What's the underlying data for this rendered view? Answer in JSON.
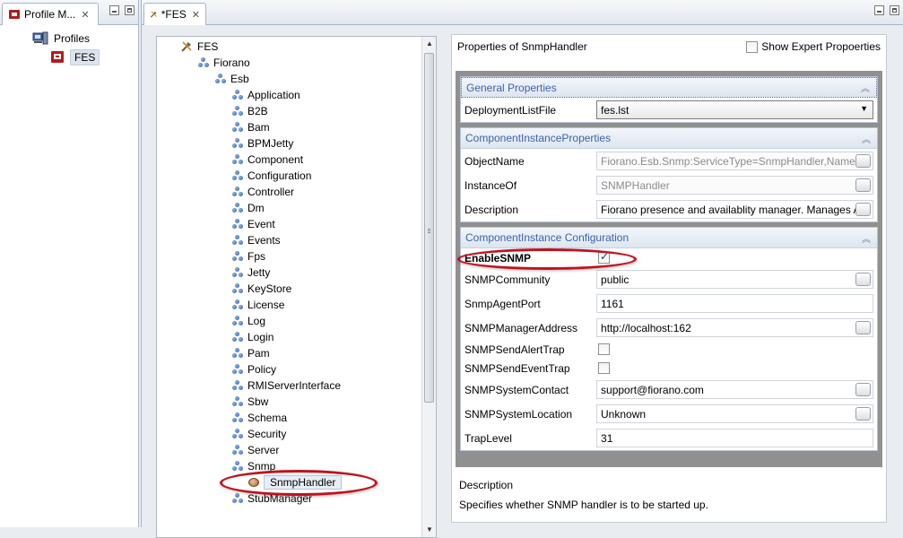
{
  "left_view": {
    "tab_title": "Profile M...",
    "tree": {
      "root": "Profiles",
      "child": "FES"
    }
  },
  "editor": {
    "tab_title": "*FES",
    "tree": {
      "nodes": [
        "FES",
        "Fiorano",
        "Esb",
        "Application",
        "B2B",
        "Bam",
        "BPMJetty",
        "Component",
        "Configuration",
        "Controller",
        "Dm",
        "Event",
        "Events",
        "Fps",
        "Jetty",
        "KeyStore",
        "License",
        "Log",
        "Login",
        "Pam",
        "Policy",
        "RMIServerInterface",
        "Sbw",
        "Schema",
        "Security",
        "Server",
        "Snmp",
        "SnmpHandler",
        "StubManager"
      ]
    }
  },
  "properties": {
    "title": "Properties of SnmpHandler",
    "expert_label": "Show Expert Propoerties",
    "sections": [
      {
        "title": "General Properties",
        "rows": [
          {
            "label": "DeploymentListFile",
            "value": "fes.lst"
          }
        ]
      },
      {
        "title": "ComponentInstanceProperties",
        "rows": [
          {
            "label": "ObjectName",
            "value": "Fiorano.Esb.Snmp:ServiceType=SnmpHandler,Name=SnmpHandler"
          },
          {
            "label": "InstanceOf",
            "value": "SNMPHandler"
          },
          {
            "label": "Description",
            "value": "Fiorano presence and availablity manager. Manages Ac"
          }
        ]
      },
      {
        "title": "ComponentInstance Configuration",
        "rows": [
          {
            "label": "EnableSNMP",
            "value": ""
          },
          {
            "label": "SNMPCommunity",
            "value": "public"
          },
          {
            "label": "SnmpAgentPort",
            "value": "1161"
          },
          {
            "label": "SNMPManagerAddress",
            "value": "http://localhost:162"
          },
          {
            "label": "SNMPSendAlertTrap",
            "value": ""
          },
          {
            "label": "SNMPSendEventTrap",
            "value": ""
          },
          {
            "label": "SNMPSystemContact",
            "value": "support@fiorano.com"
          },
          {
            "label": "SNMPSystemLocation",
            "value": "Unknown"
          },
          {
            "label": "TrapLevel",
            "value": "31"
          }
        ]
      }
    ],
    "description": {
      "title": "Description",
      "text": "Specifies whether SNMP handler is to be started up."
    }
  }
}
